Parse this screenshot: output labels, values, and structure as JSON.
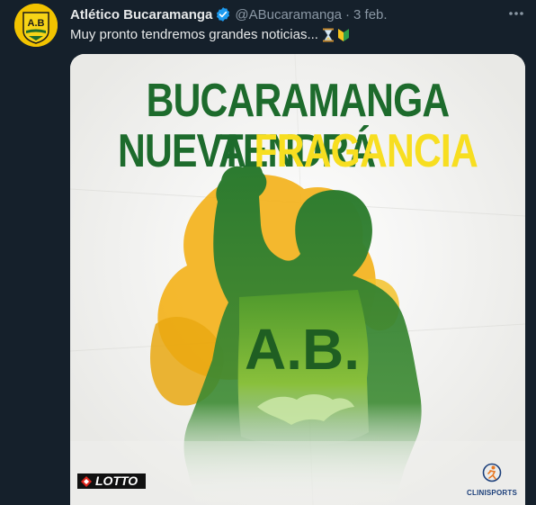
{
  "tweet": {
    "display_name": "Atlético Bucaramanga",
    "handle": "@ABucaramanga",
    "separator": "·",
    "date": "3 feb.",
    "text": "Muy pronto tendremos grandes noticias...",
    "more_icon": "more-horizontal-icon",
    "verified_icon": "verified-badge-icon",
    "avatar_text": "A.B",
    "emojis": [
      "hourglass-icon",
      "japanese-beginner-symbol-icon"
    ]
  },
  "media": {
    "headline_line1": "BUCARAMANGA TENDRÁ",
    "headline_line2_part1": "NUEVA ",
    "headline_line2_part2": "FRAGANCIA",
    "shirt_text": "A.B.",
    "sponsor_left": "LOTTO",
    "sponsor_right": "CLINISPORTS",
    "colors": {
      "green": "#1d6b2c",
      "yellow": "#f7de20",
      "orange": "#f2b800",
      "background": "#f4f4f2"
    }
  },
  "theme": {
    "background": "#15202b",
    "text_primary": "#e7e9ea",
    "text_secondary": "#8b98a5",
    "verified_blue": "#1d9bf0"
  }
}
